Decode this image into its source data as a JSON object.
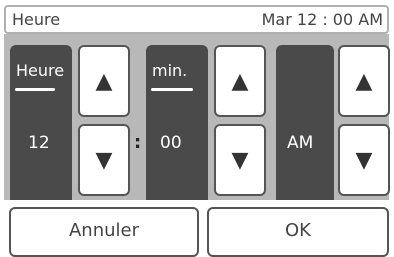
{
  "header": {
    "title": "Heure",
    "current_time": "Mar 12 : 00 AM"
  },
  "hour": {
    "label": "Heure",
    "value": "12",
    "up_icon": "triangle-up",
    "down_icon": "triangle-down"
  },
  "minute": {
    "label": "min.",
    "value": "00",
    "up_icon": "triangle-up",
    "down_icon": "triangle-down"
  },
  "separator": ":",
  "ampm": {
    "value": "AM",
    "up_icon": "triangle-up",
    "down_icon": "triangle-down"
  },
  "buttons": {
    "cancel": "Annuler",
    "ok": "OK"
  },
  "arrows": {
    "up": "▲",
    "down": "▼"
  },
  "colors": {
    "column_bg": "#4a4a4a",
    "panel_bg": "#b8b8b8",
    "button_border": "#555555"
  }
}
